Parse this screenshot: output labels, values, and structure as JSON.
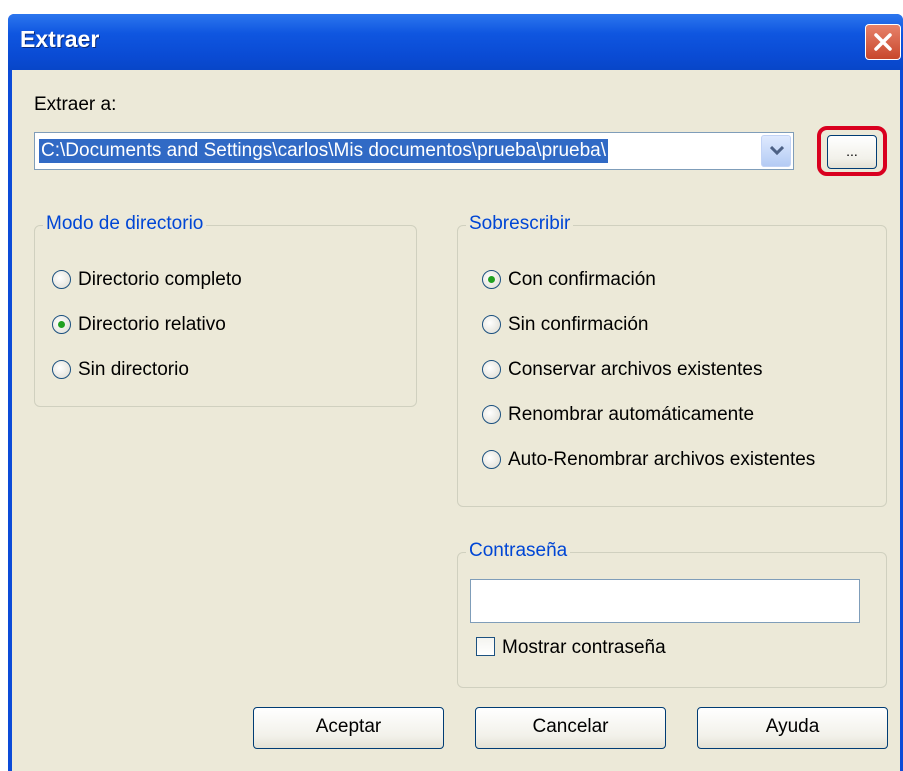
{
  "window": {
    "title": "Extraer"
  },
  "path": {
    "label": "Extraer a:",
    "value": "C:\\Documents and Settings\\carlos\\Mis documentos\\prueba\\prueba\\",
    "browse_label": "..."
  },
  "directory_mode": {
    "title": "Modo de directorio",
    "options": [
      {
        "label": "Directorio completo",
        "checked": false
      },
      {
        "label": "Directorio relativo",
        "checked": true
      },
      {
        "label": "Sin directorio",
        "checked": false
      }
    ]
  },
  "overwrite": {
    "title": "Sobrescribir",
    "options": [
      {
        "label": "Con confirmación",
        "checked": true
      },
      {
        "label": "Sin confirmación",
        "checked": false
      },
      {
        "label": "Conservar archivos existentes",
        "checked": false
      },
      {
        "label": "Renombrar automáticamente",
        "checked": false
      },
      {
        "label": "Auto-Renombrar archivos existentes",
        "checked": false
      }
    ]
  },
  "password": {
    "title": "Contraseña",
    "value": "",
    "show_label": "Mostrar contraseña",
    "show_checked": false
  },
  "buttons": {
    "accept": "Aceptar",
    "cancel": "Cancelar",
    "help": "Ayuda"
  },
  "colors": {
    "titlebar": "#0a4bd4",
    "dialog_bg": "#ece9d8",
    "highlight": "#d9001f",
    "group_title": "#0046d5",
    "radio_checked": "#21a121"
  },
  "icons": {
    "close": "close-x-icon",
    "dropdown": "chevron-down-icon"
  }
}
